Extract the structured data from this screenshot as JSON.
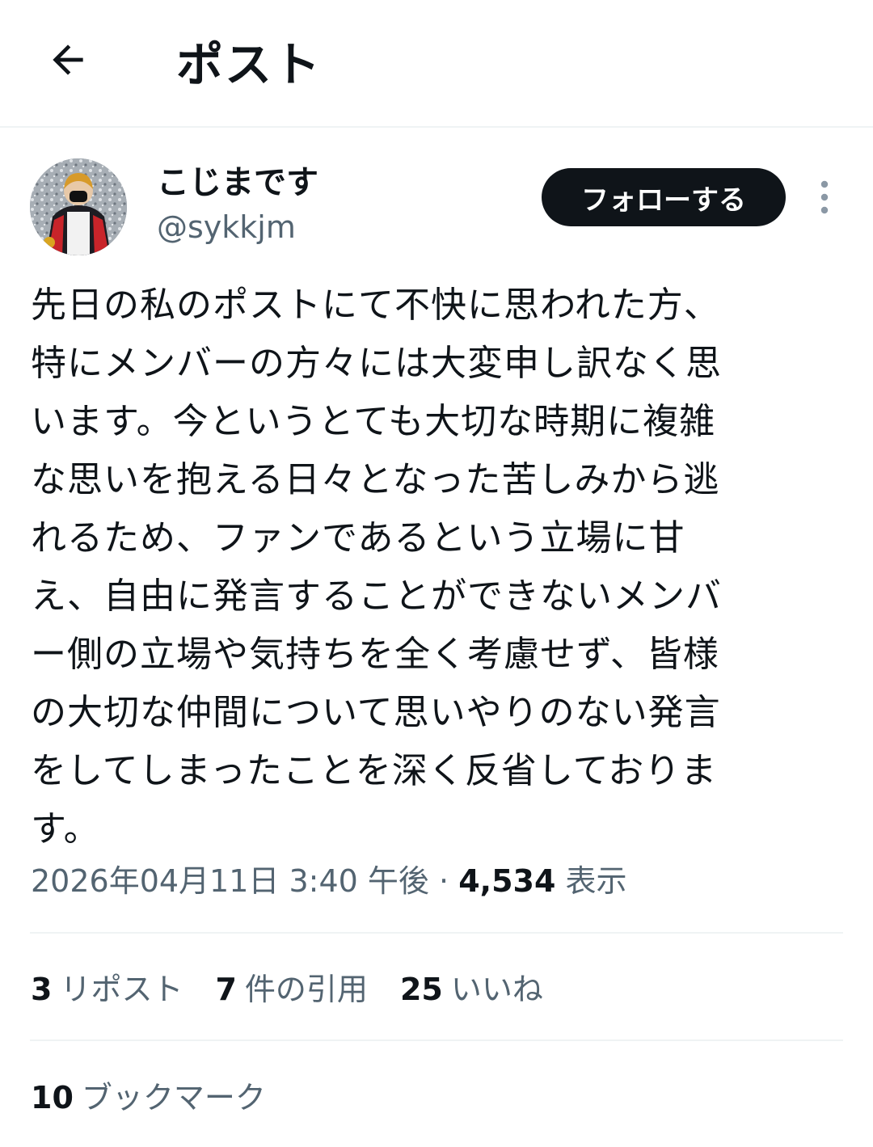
{
  "header": {
    "title": "ポスト",
    "back_icon": "arrow-left-icon"
  },
  "author": {
    "display_name": "こじまです",
    "handle": "@sykkjm",
    "avatar_icon": "user-avatar-photo"
  },
  "actions": {
    "follow_label": "フォローする",
    "more_icon": "more-vertical-icon"
  },
  "post": {
    "lines": [
      "先日の私のポストにて不快に思われた方、",
      "特にメンバーの方々には大変申し訳なく思",
      "います。今というとても大切な時期に複雑",
      "な思いを抱える日々となった苦しみから逃",
      "れるため、ファンであるという立場に甘",
      "え、自由に発言することができないメンバ",
      "ー側の立場や気持ちを全く考慮せず、皆様",
      "の大切な仲間について思いやりのない発言",
      "をしてしまったことを深く反省しておりま",
      "す。"
    ]
  },
  "meta": {
    "datetime": "2026年04月11日 3:40 午後",
    "separator": "·",
    "views_count": "4,534",
    "views_label": "表示"
  },
  "stats": {
    "reposts_count": "3",
    "reposts_label": "リポスト",
    "quotes_count": "7",
    "quotes_label": "件の引用",
    "likes_count": "25",
    "likes_label": "いいね",
    "bookmarks_count": "10",
    "bookmarks_label": "ブックマーク"
  },
  "colors": {
    "text_primary": "#0f1419",
    "text_secondary": "#536471",
    "divider": "#eff3f4",
    "button_bg": "#0f1419",
    "button_text": "#ffffff"
  }
}
